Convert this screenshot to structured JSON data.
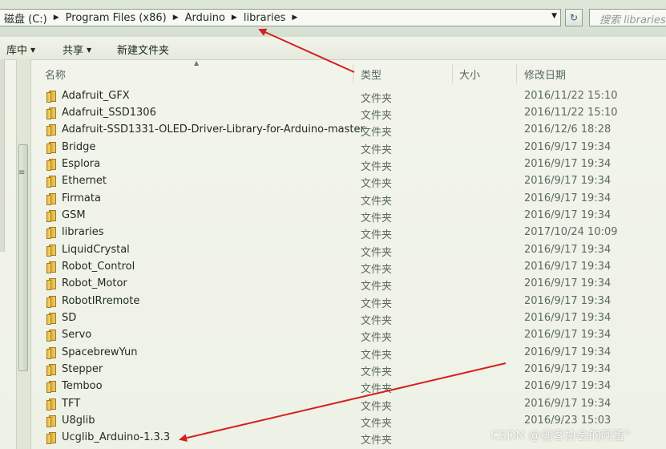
{
  "address_bar": {
    "breadcrumb": [
      "磁盘 (C:)",
      "Program Files (x86)",
      "Arduino",
      "libraries"
    ],
    "search_placeholder": "搜索 libraries"
  },
  "toolbar": {
    "include_library_label": "库中",
    "share_label": "共享",
    "new_folder_label": "新建文件夹"
  },
  "columns": {
    "name": "名称",
    "type": "类型",
    "size": "大小",
    "modified": "修改日期"
  },
  "files": [
    {
      "name": "Adafruit_GFX",
      "type": "文件夹",
      "modified": "2016/11/22 15:10"
    },
    {
      "name": "Adafruit_SSD1306",
      "type": "文件夹",
      "modified": "2016/11/22 15:10"
    },
    {
      "name": "Adafruit-SSD1331-OLED-Driver-Library-for-Arduino-master",
      "type": "文件夹",
      "modified": "2016/12/6 18:28"
    },
    {
      "name": "Bridge",
      "type": "文件夹",
      "modified": "2016/9/17 19:34"
    },
    {
      "name": "Esplora",
      "type": "文件夹",
      "modified": "2016/9/17 19:34"
    },
    {
      "name": "Ethernet",
      "type": "文件夹",
      "modified": "2016/9/17 19:34"
    },
    {
      "name": "Firmata",
      "type": "文件夹",
      "modified": "2016/9/17 19:34"
    },
    {
      "name": "GSM",
      "type": "文件夹",
      "modified": "2016/9/17 19:34"
    },
    {
      "name": "libraries",
      "type": "文件夹",
      "modified": "2017/10/24 10:09"
    },
    {
      "name": "LiquidCrystal",
      "type": "文件夹",
      "modified": "2016/9/17 19:34"
    },
    {
      "name": "Robot_Control",
      "type": "文件夹",
      "modified": "2016/9/17 19:34"
    },
    {
      "name": "Robot_Motor",
      "type": "文件夹",
      "modified": "2016/9/17 19:34"
    },
    {
      "name": "RobotIRremote",
      "type": "文件夹",
      "modified": "2016/9/17 19:34"
    },
    {
      "name": "SD",
      "type": "文件夹",
      "modified": "2016/9/17 19:34"
    },
    {
      "name": "Servo",
      "type": "文件夹",
      "modified": "2016/9/17 19:34"
    },
    {
      "name": "SpacebrewYun",
      "type": "文件夹",
      "modified": "2016/9/17 19:34"
    },
    {
      "name": "Stepper",
      "type": "文件夹",
      "modified": "2016/9/17 19:34"
    },
    {
      "name": "Temboo",
      "type": "文件夹",
      "modified": "2016/9/17 19:34"
    },
    {
      "name": "TFT",
      "type": "文件夹",
      "modified": "2016/9/17 19:34"
    },
    {
      "name": "U8glib",
      "type": "文件夹",
      "modified": "2016/9/23 15:03"
    },
    {
      "name": "Ucglib_Arduino-1.3.3",
      "type": "文件夹",
      "modified": ""
    }
  ],
  "annotation_color": "#d42020",
  "watermark": "CSDN @创客协会的阿蛋°"
}
